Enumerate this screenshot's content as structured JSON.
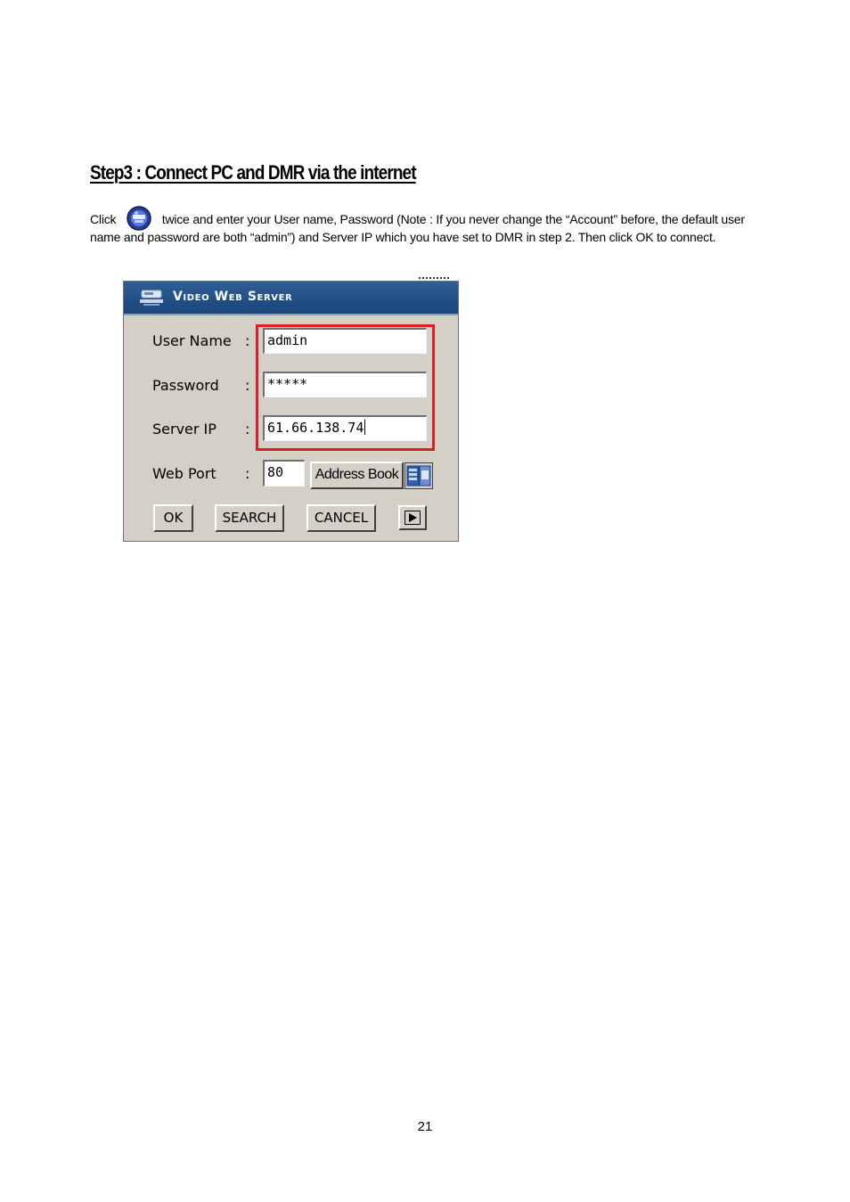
{
  "heading": "Step3 : Connect PC and DMR via the internet",
  "instructions": {
    "before_icon": "Click",
    "icon": "video-web-server-icon",
    "after_icon": "twice and enter your User name, Password (Note : If you never change the “Account” before, the default user",
    "line2": "name and password are both “admin”) and Server IP which you have set to DMR in step 2. Then click OK to connect."
  },
  "dialog": {
    "title": "Video Web Server",
    "title_icon": "server-icon",
    "fields": {
      "user_name": {
        "label": "User Name",
        "colon": ":",
        "value": "admin"
      },
      "password": {
        "label": "Password",
        "colon": ":",
        "value": "*****"
      },
      "server_ip": {
        "label": "Server IP",
        "colon": ":",
        "value": "61.66.138.74"
      },
      "web_port": {
        "label": "Web Port",
        "colon": ":",
        "value": "80"
      }
    },
    "address_book_label": "Address Book",
    "address_book_icon": "address-book-icon",
    "buttons": {
      "ok": "OK",
      "search": "SEARCH",
      "cancel": "CANCEL"
    },
    "next_icon": "play-arrow-icon",
    "highlight_color": "#e31b23",
    "title_bar_color": "#1f4f86",
    "window_color": "#d4d0c8"
  },
  "page_number": "21"
}
